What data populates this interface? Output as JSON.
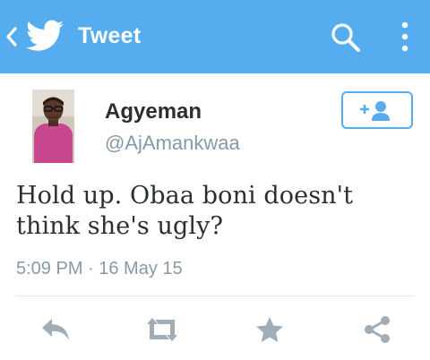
{
  "header": {
    "title": "Tweet",
    "icons": [
      "chevron-left-icon",
      "twitter-bird-icon",
      "search-icon",
      "overflow-menu-icon"
    ],
    "background": "#55acee"
  },
  "tweet": {
    "author_name": "Agyeman",
    "author_handle": "@AjAmankwaa",
    "text": "Hold up. Obaa boni doesn't think she's ugly?",
    "timestamp": "5:09 PM · 16 May 15"
  },
  "follow_button": {
    "label": "+👤"
  },
  "actions": [
    "reply-icon",
    "retweet-icon",
    "favorite-icon",
    "share-icon"
  ],
  "colors": {
    "accent": "#55acee",
    "text": "#292f33",
    "muted": "#8899a6",
    "action_icons": "#a0adb7"
  }
}
